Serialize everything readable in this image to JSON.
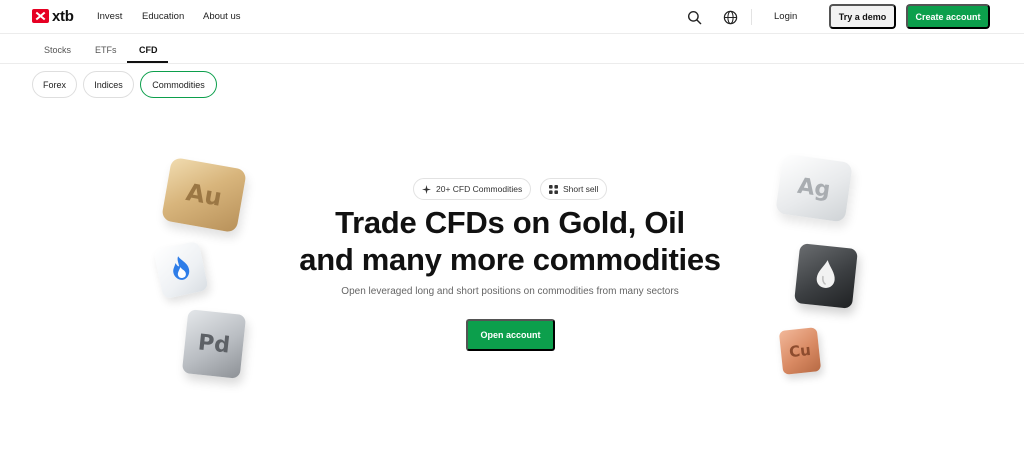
{
  "brand": {
    "name": "xtb",
    "color": "#e60023"
  },
  "nav": {
    "links": [
      "Invest",
      "Education",
      "About us"
    ],
    "search_icon": "search-icon",
    "globe_icon": "globe-icon",
    "login": "Login",
    "try_demo": "Try a demo",
    "create_account": "Create account"
  },
  "subnav": {
    "tabs": [
      "Stocks",
      "ETFs",
      "CFD"
    ],
    "active": "CFD"
  },
  "filters": {
    "pills": [
      "Forex",
      "Indices",
      "Commodities"
    ],
    "active": "Commodities"
  },
  "hero": {
    "tags": [
      {
        "icon": "sparkle-icon",
        "label": "20+ CFD Commodities"
      },
      {
        "icon": "grid-icon",
        "label": "Short sell"
      }
    ],
    "title_line1": "Trade CFDs on Gold, Oil",
    "title_line2": "and many more commodities",
    "subtitle": "Open leveraged long and short positions on commodities from many sectors",
    "cta": "Open account"
  },
  "tiles": {
    "gold": "Au",
    "palladium": "Pd",
    "silver": "Ag",
    "copper": "Cu",
    "gas_icon": "flame-icon",
    "oil_icon": "oil-drop-icon"
  },
  "colors": {
    "accent": "#0c9f4c",
    "text": "#111111",
    "muted": "#666666"
  }
}
